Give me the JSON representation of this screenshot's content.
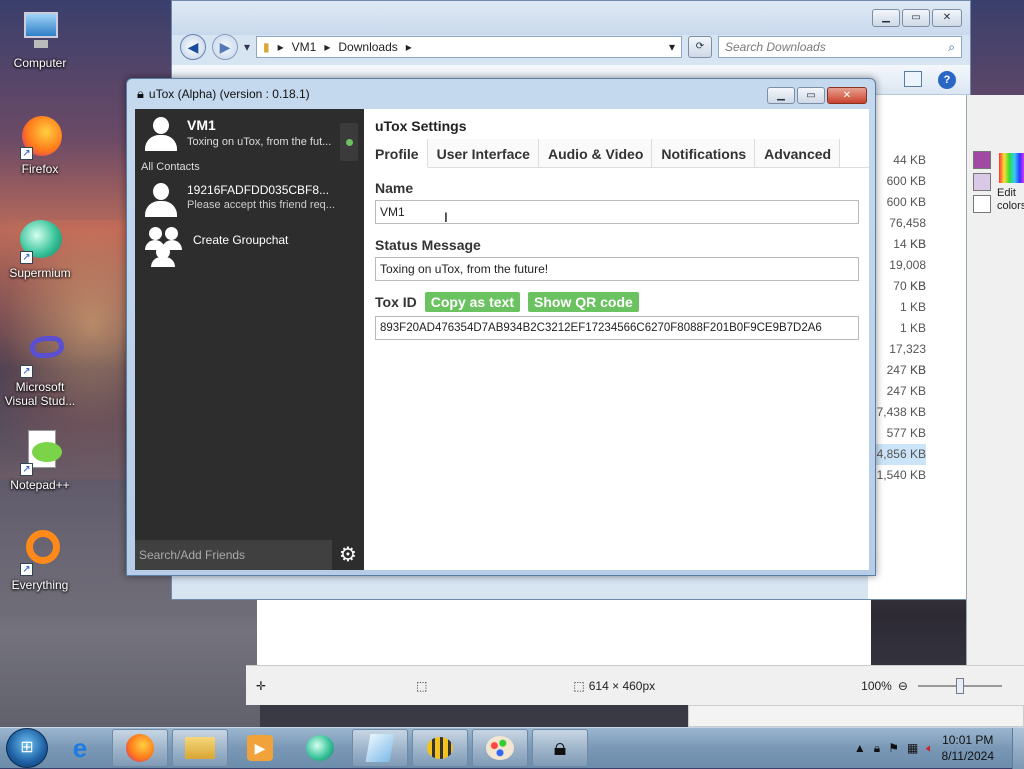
{
  "desktop": {
    "icons": [
      {
        "label": "Computer",
        "icon": "computer-icon"
      },
      {
        "label": "Firefox",
        "icon": "firefox-icon"
      },
      {
        "label": "Supermium",
        "icon": "supermium-icon"
      },
      {
        "label": "Microsoft Visual Stud...",
        "icon": "vscode-icon"
      },
      {
        "label": "Notepad++",
        "icon": "notepadpp-icon"
      },
      {
        "label": "Everything",
        "icon": "everything-icon"
      }
    ]
  },
  "explorer": {
    "path": [
      "VM1",
      "Downloads"
    ],
    "search_placeholder": "Search Downloads",
    "sizes": [
      "44 KB",
      "600 KB",
      "600 KB",
      "76,458 KB",
      "14 KB",
      "19,008 KB",
      "70 KB",
      "1 KB",
      "1 KB",
      "17,323 KB",
      "247 KB",
      "247 KB",
      "7,438 KB",
      "577 KB",
      "4,856 KB",
      "1,540 KB"
    ]
  },
  "paint": {
    "edit_colors": "Edit colors",
    "size_readout": "614 × 460px",
    "zoom": "100%"
  },
  "utox": {
    "title": "uTox (Alpha) (version : 0.18.1)",
    "self": {
      "name": "VM1",
      "status": "Toxing on uTox, from the fut..."
    },
    "all_contacts": "All Contacts",
    "friend": {
      "name": "19216FADFDD035CBF8...",
      "sub": "Please accept this friend req..."
    },
    "create_group": "Create Groupchat",
    "search_placeholder": "Search/Add Friends",
    "settings_title": "uTox Settings",
    "tabs": [
      "Profile",
      "User Interface",
      "Audio & Video",
      "Notifications",
      "Advanced"
    ],
    "name_label": "Name",
    "name_value": "VM1",
    "status_label": "Status Message",
    "status_value": "Toxing on uTox, from the future!",
    "toxid_label": "Tox ID",
    "copy_text": "Copy as text",
    "show_qr": "Show QR code",
    "toxid_value": "893F20AD476354D7AB934B2C3212EF17234566C6270F8088F201B0F9CE9B7D2A6"
  },
  "taskbar": {
    "time": "10:01 PM",
    "date": "8/11/2024"
  },
  "colors": {
    "accent_green": "#6bc260",
    "sidebar": "#2d2d2d"
  }
}
